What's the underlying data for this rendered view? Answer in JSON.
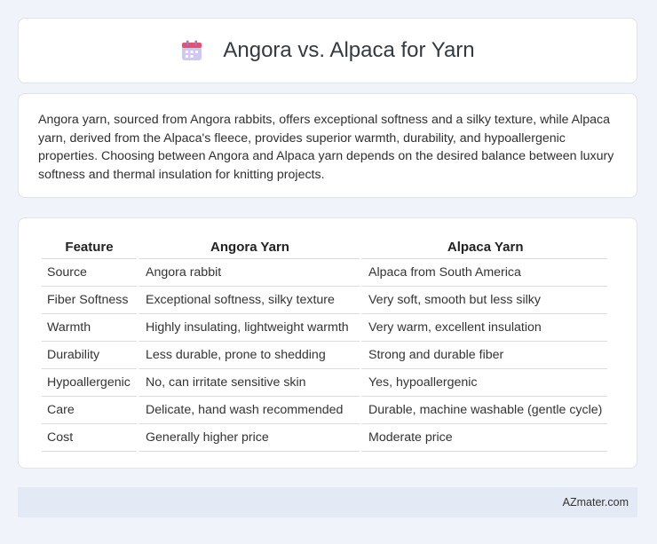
{
  "header": {
    "icon": "calendar-icon",
    "title": "Angora vs. Alpaca for Yarn"
  },
  "intro": {
    "text": "Angora yarn, sourced from Angora rabbits, offers exceptional softness and a silky texture, while Alpaca yarn, derived from the Alpaca's fleece, provides superior warmth, durability, and hypoallergenic properties. Choosing between Angora and Alpaca yarn depends on the desired balance between luxury softness and thermal insulation for knitting projects."
  },
  "table": {
    "headers": [
      "Feature",
      "Angora Yarn",
      "Alpaca Yarn"
    ],
    "rows": [
      [
        "Source",
        "Angora rabbit",
        "Alpaca from South America"
      ],
      [
        "Fiber Softness",
        "Exceptional softness, silky texture",
        "Very soft, smooth but less silky"
      ],
      [
        "Warmth",
        "Highly insulating, lightweight warmth",
        "Very warm, excellent insulation"
      ],
      [
        "Durability",
        "Less durable, prone to shedding",
        "Strong and durable fiber"
      ],
      [
        "Hypoallergenic",
        "No, can irritate sensitive skin",
        "Yes, hypoallergenic"
      ],
      [
        "Care",
        "Delicate, hand wash recommended",
        "Durable, machine washable (gentle cycle)"
      ],
      [
        "Cost",
        "Generally higher price",
        "Moderate price"
      ]
    ]
  },
  "footer": {
    "brand": "AZmater.com"
  },
  "colors": {
    "background": "#f0f3f9",
    "footer": "#e3e9f5",
    "icon_top": "#e8506b",
    "icon_body": "#c9c2f0"
  }
}
